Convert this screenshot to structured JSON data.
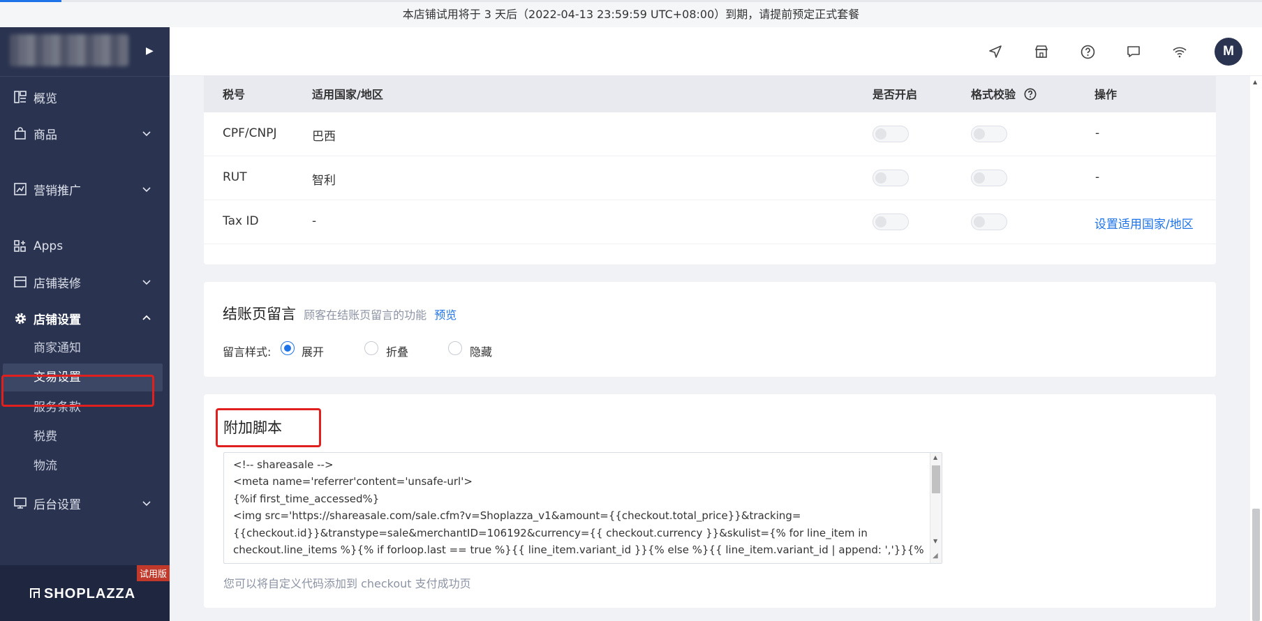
{
  "banner": {
    "text": "本店铺试用将于 3 天后（2022-04-13 23:59:59 UTC+08:00）到期，请提前预定正式套餐"
  },
  "sidebar": {
    "nav": [
      {
        "label": "概览",
        "icon": "overview-icon"
      },
      {
        "label": "商品",
        "icon": "bag-icon"
      },
      {
        "label": "营销推广",
        "icon": "marketing-icon"
      },
      {
        "label": "Apps",
        "icon": "apps-icon"
      },
      {
        "label": "店铺装修",
        "icon": "store-design-icon"
      },
      {
        "label": "店铺设置",
        "icon": "gear-icon"
      },
      {
        "label": "后台设置",
        "icon": "monitor-icon"
      }
    ],
    "sub": [
      "商家通知",
      "交易设置",
      "服务条款",
      "税费",
      "物流"
    ],
    "brand": "SHOPLAZZA",
    "trial_tag": "试用版"
  },
  "topbar": {
    "avatar": "M"
  },
  "tax_table": {
    "headers": [
      "税号",
      "适用国家/地区",
      "是否开启",
      "格式校验",
      "操作"
    ],
    "rows": [
      {
        "id": "CPF/CNPJ",
        "region": "巴西",
        "action": "-"
      },
      {
        "id": "RUT",
        "region": "智利",
        "action": "-"
      },
      {
        "id": "Tax ID",
        "region": "-",
        "action": "设置适用国家/地区"
      }
    ]
  },
  "checkout_message": {
    "title": "结账页留言",
    "desc": "顾客在结账页留言的功能",
    "preview": "预览",
    "style_label": "留言样式:",
    "options": [
      "展开",
      "折叠",
      "隐藏"
    ]
  },
  "additional_script": {
    "title": "附加脚本",
    "code": [
      "<!-- shareasale -->",
      "<meta name='referrer'content='unsafe-url'>",
      "{%if first_time_accessed%}",
      "<img src='https://shareasale.com/sale.cfm?v=Shoplazza_v1&amount={{checkout.total_price}}&tracking=",
      "{{checkout.id}}&transtype=sale&merchantID=106192&currency={{ checkout.currency }}&skulist={% for line_item in",
      "checkout.line_items %}{% if forloop.last == true %}{{ line_item.variant_id }}{% else %}{{ line_item.variant_id | append: ','}}{% endif %}{%"
    ],
    "hint": "您可以将自定义代码添加到 checkout 支付成功页"
  }
}
